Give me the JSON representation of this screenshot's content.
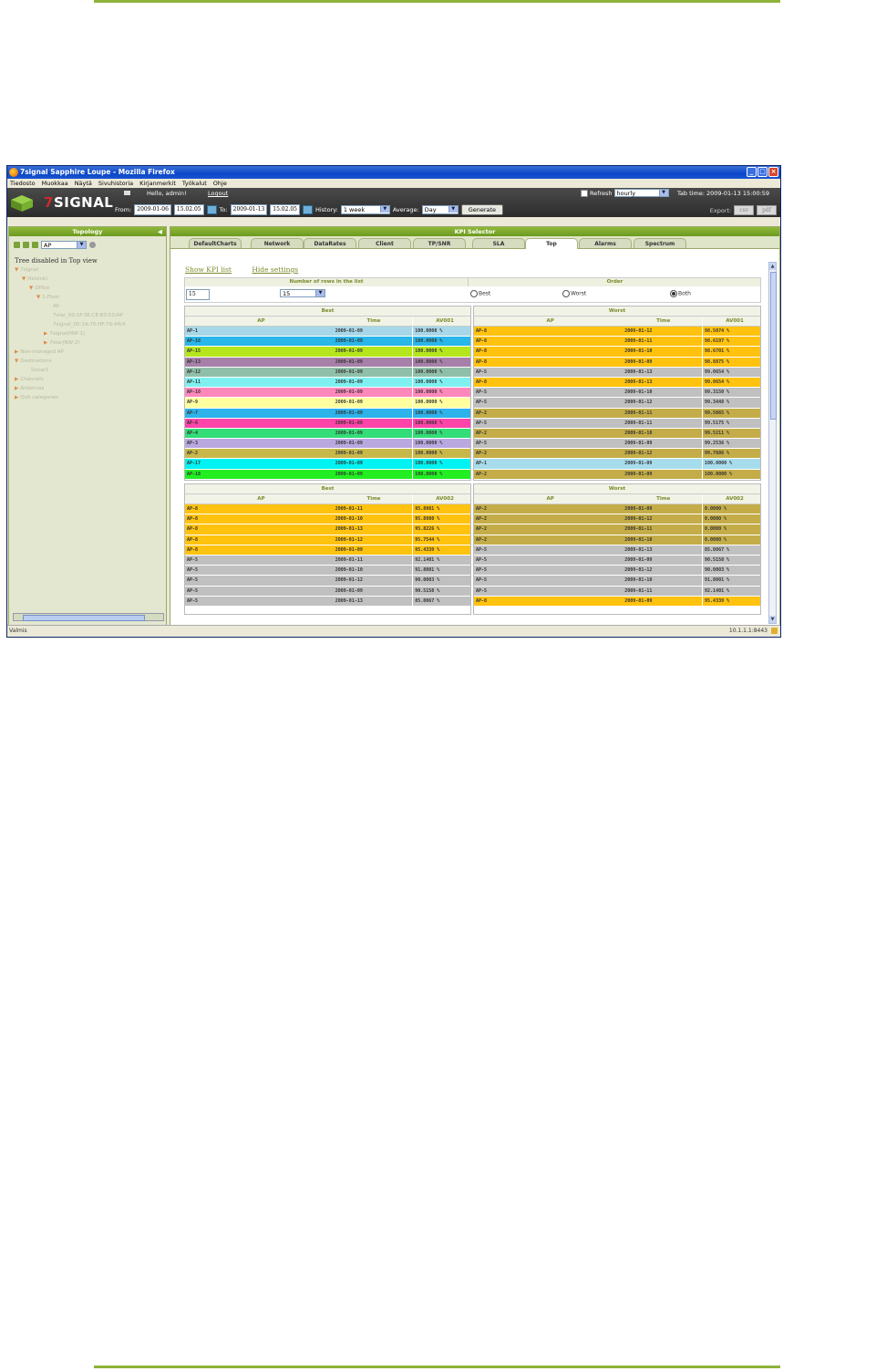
{
  "window": {
    "title": "7signal Sapphire Loupe - Mozilla Firefox"
  },
  "menu": [
    "Tiedosto",
    "Muokkaa",
    "Näytä",
    "Sivuhistoria",
    "Kirjanmerkit",
    "Työkalut",
    "Ohje"
  ],
  "app": {
    "logo_prefix": "7",
    "logo_text": "SIGNAL",
    "greeting": "Hello, admin!",
    "logout": "Logout",
    "refresh_label": "Refresh",
    "refresh_value": "hourly",
    "tab_time": "Tab time: 2009-01-13 15:00:59",
    "from_label": "From:",
    "from_date": "2009-01-06",
    "from_time": "15.02.05",
    "to_label": "To:",
    "to_date": "2009-01-13",
    "to_time": "15.02.05",
    "history_label": "History:",
    "history_value": "1 week",
    "average_label": "Average:",
    "average_value": "Day",
    "generate": "Generate",
    "export_label": "Export:",
    "export_csv": "csv",
    "export_pdf": "pdf"
  },
  "topology": {
    "title": "Topology",
    "filter_value": "AP",
    "disabled_text": "Tree disabled in Top view",
    "tree": [
      {
        "label": "7signal",
        "indent": 0,
        "toggle": "▼"
      },
      {
        "label": "Helsinki",
        "indent": 1,
        "toggle": "▼"
      },
      {
        "label": "Office",
        "indent": 2,
        "toggle": "▼"
      },
      {
        "label": "1-Floor",
        "indent": 3,
        "toggle": "▼"
      },
      {
        "label": "All",
        "indent": 5,
        "toggle": ""
      },
      {
        "label": "7star_00:1F:3E:CE:83:51(AP",
        "indent": 5,
        "toggle": ""
      },
      {
        "label": "7signal_00:1A:70:HF:79:44(4",
        "indent": 5,
        "toggle": ""
      },
      {
        "label": "7signal(NW-1)",
        "indent": 4,
        "toggle": "▶"
      },
      {
        "label": "7star(NW-2)",
        "indent": 4,
        "toggle": "▶"
      },
      {
        "label": "Non-managed AP",
        "indent": 0,
        "toggle": "▶"
      },
      {
        "label": "Destinations",
        "indent": 0,
        "toggle": "▼"
      },
      {
        "label": "Sonar1",
        "indent": 2,
        "toggle": ""
      },
      {
        "label": "Channels",
        "indent": 0,
        "toggle": "▶"
      },
      {
        "label": "Antennas",
        "indent": 0,
        "toggle": "▶"
      },
      {
        "label": "QoS categories",
        "indent": 0,
        "toggle": "▶"
      }
    ]
  },
  "kpi": {
    "title": "KPI Selector",
    "tabs": [
      "DefaultCharts",
      "Network",
      "DataRates",
      "Client",
      "TP/SNR",
      "SLA",
      "Top",
      "Alarms",
      "Spectrum"
    ],
    "active_tab": "Top",
    "show_kpi_list": "Show KPI list",
    "hide_settings": "Hide settings",
    "rows_header": "Number of rows in the list",
    "rows_input": "15",
    "rows_select": "15",
    "order_header": "Order",
    "order_best": "Best",
    "order_worst": "Worst",
    "order_both": "Both",
    "order_selected": "Both",
    "col_ap": "AP",
    "col_time": "Time",
    "best_caption": "Best",
    "worst_caption": "Worst",
    "kpi1": "AV001",
    "kpi2": "AV002"
  },
  "colors": {
    "green_header": "#7aa52a",
    "blue": "#a7d7e8",
    "cyan": "#29b6e8",
    "lime": "#b5e61d",
    "purple": "#a680a8",
    "teal": "#8fbfa8",
    "aqua": "#7ff0f0",
    "pink": "#ff88bb",
    "yellow": "#ffffa0",
    "sky": "#2eb2ea",
    "magenta": "#ff44aa",
    "green": "#33dd77",
    "lavender": "#b9a8e0",
    "olive": "#c8b84a",
    "brightcyan": "#00f2f2",
    "brightgreen": "#22ee22",
    "orange": "#ffc20e",
    "gray": "#c0c0c0",
    "khaki": "#c4ad48",
    "lightblue": "#a7dcec"
  },
  "table1_best": [
    {
      "ap": "AP-1",
      "time": "2009-01-09",
      "val": "100.0000 %",
      "c": "blue"
    },
    {
      "ap": "AP-16",
      "time": "2009-01-09",
      "val": "100.0000 %",
      "c": "cyan"
    },
    {
      "ap": "AP-15",
      "time": "2009-01-09",
      "val": "100.0000 %",
      "c": "lime"
    },
    {
      "ap": "AP-13",
      "time": "2009-01-09",
      "val": "100.0000 %",
      "c": "purple"
    },
    {
      "ap": "AP-12",
      "time": "2009-01-09",
      "val": "100.0000 %",
      "c": "teal"
    },
    {
      "ap": "AP-11",
      "time": "2009-01-09",
      "val": "100.0000 %",
      "c": "aqua"
    },
    {
      "ap": "AP-10",
      "time": "2009-01-09",
      "val": "100.0000 %",
      "c": "pink"
    },
    {
      "ap": "AP-9",
      "time": "2009-01-09",
      "val": "100.0000 %",
      "c": "yellow"
    },
    {
      "ap": "AP-7",
      "time": "2009-01-09",
      "val": "100.0000 %",
      "c": "sky"
    },
    {
      "ap": "AP-6",
      "time": "2009-01-09",
      "val": "100.0000 %",
      "c": "magenta"
    },
    {
      "ap": "AP-4",
      "time": "2009-01-09",
      "val": "100.0000 %",
      "c": "green"
    },
    {
      "ap": "AP-3",
      "time": "2009-01-09",
      "val": "100.0000 %",
      "c": "lavender"
    },
    {
      "ap": "AP-2",
      "time": "2009-01-09",
      "val": "100.0000 %",
      "c": "olive"
    },
    {
      "ap": "AP-17",
      "time": "2009-01-09",
      "val": "100.0000 %",
      "c": "brightcyan"
    },
    {
      "ap": "AP-18",
      "time": "2009-01-09",
      "val": "100.0000 %",
      "c": "brightgreen"
    }
  ],
  "table1_worst": [
    {
      "ap": "AP-8",
      "time": "2009-01-12",
      "val": "98.5074 %",
      "c": "orange"
    },
    {
      "ap": "AP-8",
      "time": "2009-01-11",
      "val": "98.6197 %",
      "c": "orange"
    },
    {
      "ap": "AP-8",
      "time": "2009-01-10",
      "val": "98.6701 %",
      "c": "orange"
    },
    {
      "ap": "AP-8",
      "time": "2009-01-09",
      "val": "98.8875 %",
      "c": "orange"
    },
    {
      "ap": "AP-5",
      "time": "2009-01-13",
      "val": "99.0654 %",
      "c": "gray"
    },
    {
      "ap": "AP-8",
      "time": "2009-01-13",
      "val": "99.0654 %",
      "c": "orange"
    },
    {
      "ap": "AP-5",
      "time": "2009-01-10",
      "val": "99.3150 %",
      "c": "gray"
    },
    {
      "ap": "AP-5",
      "time": "2009-01-12",
      "val": "99.3448 %",
      "c": "gray"
    },
    {
      "ap": "AP-2",
      "time": "2009-01-11",
      "val": "99.5065 %",
      "c": "khaki"
    },
    {
      "ap": "AP-5",
      "time": "2009-01-11",
      "val": "99.5175 %",
      "c": "gray"
    },
    {
      "ap": "AP-2",
      "time": "2009-01-10",
      "val": "99.5211 %",
      "c": "khaki"
    },
    {
      "ap": "AP-5",
      "time": "2009-01-09",
      "val": "99.2536 %",
      "c": "gray"
    },
    {
      "ap": "AP-2",
      "time": "2009-01-12",
      "val": "99.7686 %",
      "c": "khaki"
    },
    {
      "ap": "AP-1",
      "time": "2009-01-09",
      "val": "100.0000 %",
      "c": "lightblue"
    },
    {
      "ap": "AP-2",
      "time": "2009-01-09",
      "val": "100.0000 %",
      "c": "khaki"
    }
  ],
  "table2_best": [
    {
      "ap": "AP-8",
      "time": "2009-01-11",
      "val": "95.8981 %",
      "c": "orange"
    },
    {
      "ap": "AP-8",
      "time": "2009-01-10",
      "val": "95.8980 %",
      "c": "orange"
    },
    {
      "ap": "AP-8",
      "time": "2009-01-13",
      "val": "95.8226 %",
      "c": "orange"
    },
    {
      "ap": "AP-8",
      "time": "2009-01-12",
      "val": "95.7544 %",
      "c": "orange"
    },
    {
      "ap": "AP-8",
      "time": "2009-01-09",
      "val": "95.4339 %",
      "c": "orange"
    },
    {
      "ap": "AP-5",
      "time": "2009-01-11",
      "val": "92.1401 %",
      "c": "gray"
    },
    {
      "ap": "AP-5",
      "time": "2009-01-10",
      "val": "91.8001 %",
      "c": "gray"
    },
    {
      "ap": "AP-5",
      "time": "2009-01-12",
      "val": "90.0003 %",
      "c": "gray"
    },
    {
      "ap": "AP-5",
      "time": "2009-01-09",
      "val": "90.5158 %",
      "c": "gray"
    },
    {
      "ap": "AP-5",
      "time": "2009-01-13",
      "val": "85.0067 %",
      "c": "gray"
    }
  ],
  "table2_worst": [
    {
      "ap": "AP-2",
      "time": "2009-01-09",
      "val": "0.0000 %",
      "c": "khaki"
    },
    {
      "ap": "AP-2",
      "time": "2009-01-12",
      "val": "0.0000 %",
      "c": "khaki"
    },
    {
      "ap": "AP-2",
      "time": "2009-01-11",
      "val": "0.0000 %",
      "c": "khaki"
    },
    {
      "ap": "AP-2",
      "time": "2009-01-10",
      "val": "0.0000 %",
      "c": "khaki"
    },
    {
      "ap": "AP-5",
      "time": "2009-01-13",
      "val": "85.0067 %",
      "c": "gray"
    },
    {
      "ap": "AP-5",
      "time": "2009-01-09",
      "val": "90.5158 %",
      "c": "gray"
    },
    {
      "ap": "AP-5",
      "time": "2009-01-12",
      "val": "90.0003 %",
      "c": "gray"
    },
    {
      "ap": "AP-5",
      "time": "2009-01-10",
      "val": "91.8001 %",
      "c": "gray"
    },
    {
      "ap": "AP-5",
      "time": "2009-01-11",
      "val": "92.1401 %",
      "c": "gray"
    },
    {
      "ap": "AP-8",
      "time": "2009-01-09",
      "val": "95.4339 %",
      "c": "orange"
    }
  ],
  "statusbar": {
    "left": "Valmis",
    "right": "10.1.1.1:8443"
  }
}
